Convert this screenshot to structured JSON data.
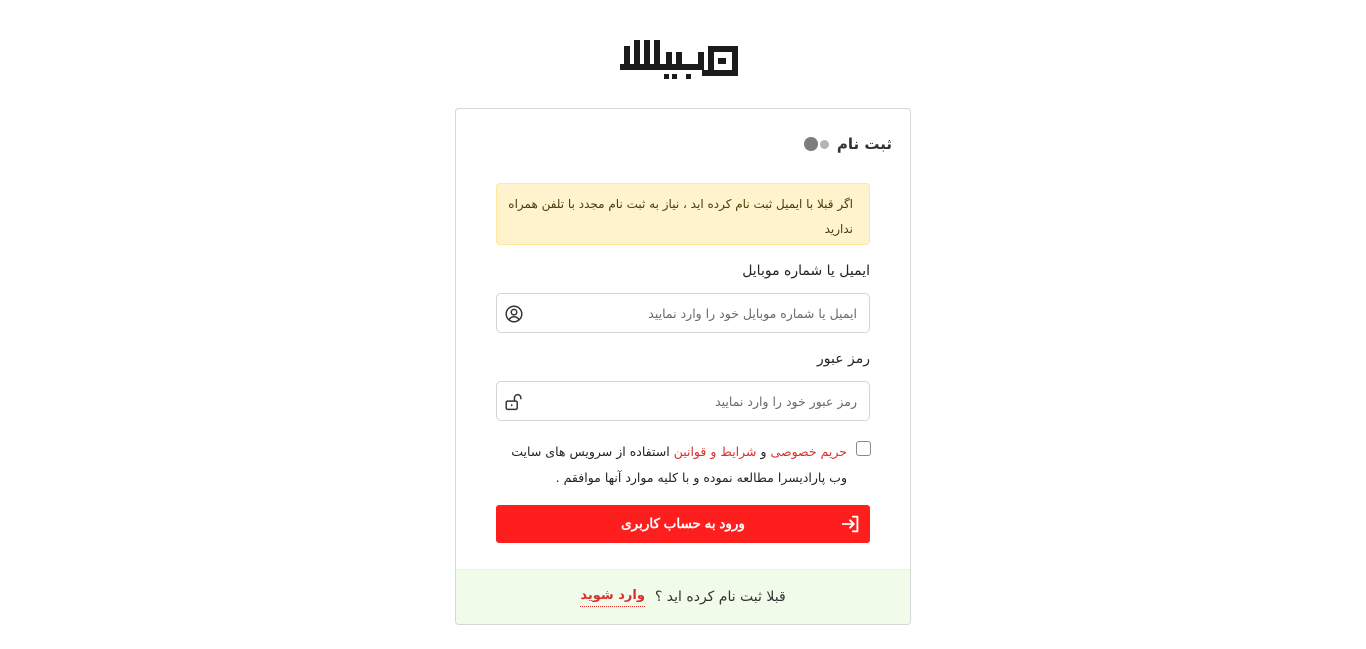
{
  "card": {
    "title": "ثبت نام"
  },
  "alert": {
    "text": "اگر قبلا با ایمیل ثبت نام کرده اید ، نیاز به ثبت نام مجدد با تلفن همراه ندارید"
  },
  "form": {
    "email_label": "ایمیل یا شماره موبایل",
    "email_placeholder": "ایمیل یا شماره موبایل خود را وارد نمایید",
    "email_value": "",
    "email_icon": "user-circle-icon",
    "password_label": "رمز عبور",
    "password_placeholder": "رمز عبور خود را وارد نمایید",
    "password_value": "",
    "password_icon": "unlock-icon",
    "terms": {
      "checked": false,
      "privacy_link": "حریم خصوصی",
      "and": "و",
      "rules_link": "شرایط و قوانین",
      "text_after": "استفاده از سرویس های سایت وب پارادیسرا مطالعه نموده و با کلیه موارد آنها موافقم ."
    },
    "submit_label": "ورود به حساب کاربری",
    "submit_icon": "login-arrow-icon"
  },
  "footer": {
    "question": "قبلا ثبت نام کرده اید ؟",
    "login_link": "وارد شوید"
  },
  "colors": {
    "primary": "#ff1e1e",
    "link": "#d9302c",
    "alert_bg": "#fff3cd",
    "footer_bg": "#f1fbea"
  }
}
